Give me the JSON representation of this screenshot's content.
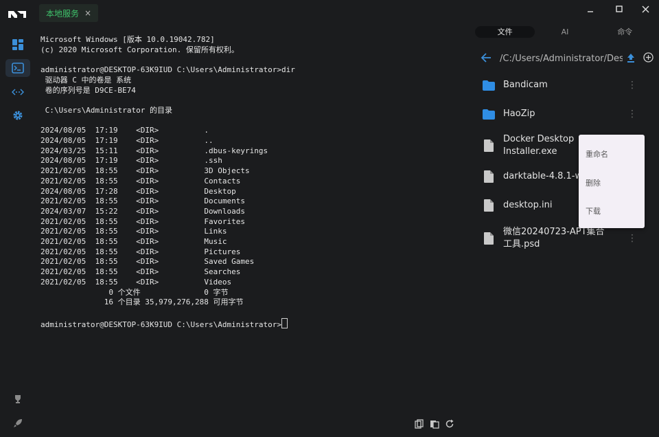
{
  "tab": {
    "title": "本地服务",
    "close": "×"
  },
  "sidebar": {
    "icons": [
      "app-logo",
      "dashboard-icon",
      "terminal-icon",
      "transfer-icon",
      "settings-icon"
    ],
    "bottom_icons": [
      "trophy-icon",
      "rocket-icon"
    ],
    "active_color": "#3b8fd9"
  },
  "terminal": {
    "lines": [
      "Microsoft Windows [版本 10.0.19042.782]",
      "(c) 2020 Microsoft Corporation. 保留所有权利。",
      "",
      "administrator@DESKTOP-63K9IUD C:\\Users\\Administrator>dir",
      " 驱动器 C 中的卷是 系统",
      " 卷的序列号是 D9CE-BE74",
      "",
      " C:\\Users\\Administrator 的目录",
      "",
      "2024/08/05  17:19    <DIR>          .",
      "2024/08/05  17:19    <DIR>          ..",
      "2024/03/25  15:11    <DIR>          .dbus-keyrings",
      "2024/08/05  17:19    <DIR>          .ssh",
      "2021/02/05  18:55    <DIR>          3D Objects",
      "2021/02/05  18:55    <DIR>          Contacts",
      "2024/08/05  17:28    <DIR>          Desktop",
      "2021/02/05  18:55    <DIR>          Documents",
      "2024/03/07  15:22    <DIR>          Downloads",
      "2021/02/05  18:55    <DIR>          Favorites",
      "2021/02/05  18:55    <DIR>          Links",
      "2021/02/05  18:55    <DIR>          Music",
      "2021/02/05  18:55    <DIR>          Pictures",
      "2021/02/05  18:55    <DIR>          Saved Games",
      "2021/02/05  18:55    <DIR>          Searches",
      "2021/02/05  18:55    <DIR>          Videos",
      "               0 个文件              0 字节",
      "              16 个目录 35,979,276,288 可用字节",
      ""
    ],
    "prompt": "administrator@DESKTOP-63K9IUD C:\\Users\\Administrator>"
  },
  "window_controls": {
    "minimize": "minimize-icon",
    "maximize": "maximize-icon",
    "close": "close-icon"
  },
  "right_panel": {
    "tabs": [
      "文件",
      "AI",
      "命令"
    ],
    "active_tab": 0,
    "path": "/C:/Users/Administrator/Des",
    "files": [
      {
        "name": "Bandicam",
        "type": "folder"
      },
      {
        "name": "HaoZip",
        "type": "folder"
      },
      {
        "name": "Docker Desktop Installer.exe",
        "type": "file"
      },
      {
        "name": "darktable-4.8.1-wi",
        "type": "file"
      },
      {
        "name": "desktop.ini",
        "type": "file"
      },
      {
        "name": "微信20240723-APT集合工具.psd",
        "type": "file"
      }
    ],
    "folder_color": "#2f8de4"
  },
  "context_menu": {
    "items": [
      "重命名",
      "删除",
      "下载"
    ]
  }
}
